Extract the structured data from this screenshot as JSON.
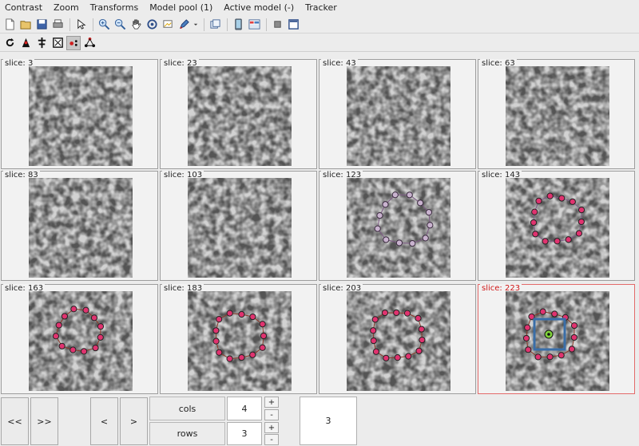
{
  "menu": [
    "Contrast",
    "Zoom",
    "Transforms",
    "Model pool (1)",
    "Active model (-)",
    "Tracker"
  ],
  "toolbar1_icons": [
    "new-file-icon",
    "open-folder-icon",
    "save-icon",
    "print-icon",
    "pointer-icon",
    "zoom-in-icon",
    "zoom-out-icon",
    "pan-hand-icon",
    "rotate-icon",
    "annotate-icon",
    "pen-icon",
    "copy-icon",
    "panel-icon",
    "layout-icon",
    "stop-icon",
    "window-icon"
  ],
  "toolbar2_icons": [
    "refresh-icon",
    "model-icon",
    "tree-icon",
    "crop-icon",
    "points-icon",
    "tracker-icon"
  ],
  "slices": [
    {
      "label": "slice: 3"
    },
    {
      "label": "slice: 23"
    },
    {
      "label": "slice: 43"
    },
    {
      "label": "slice: 63"
    },
    {
      "label": "slice: 83"
    },
    {
      "label": "slice: 103"
    },
    {
      "label": "slice: 123"
    },
    {
      "label": "slice: 143"
    },
    {
      "label": "slice: 163"
    },
    {
      "label": "slice: 183"
    },
    {
      "label": "slice: 203"
    },
    {
      "label": "slice: 223"
    }
  ],
  "active_slice_index": 11,
  "nav": {
    "first": "<<",
    "last": ">>",
    "prev": "<",
    "next": ">"
  },
  "cols": {
    "label": "cols",
    "value": "4",
    "inc": "+",
    "dec": "-"
  },
  "rows": {
    "label": "rows",
    "value": "3",
    "inc": "+",
    "dec": "-"
  },
  "current_value": "3",
  "colors": {
    "point": "#e0336f",
    "point_faint": "#c9b3cf",
    "path": "#8b3a2a",
    "path_faint": "#7e5a86",
    "selection": "#3a6ea8",
    "active_border": "#e36a6a"
  }
}
